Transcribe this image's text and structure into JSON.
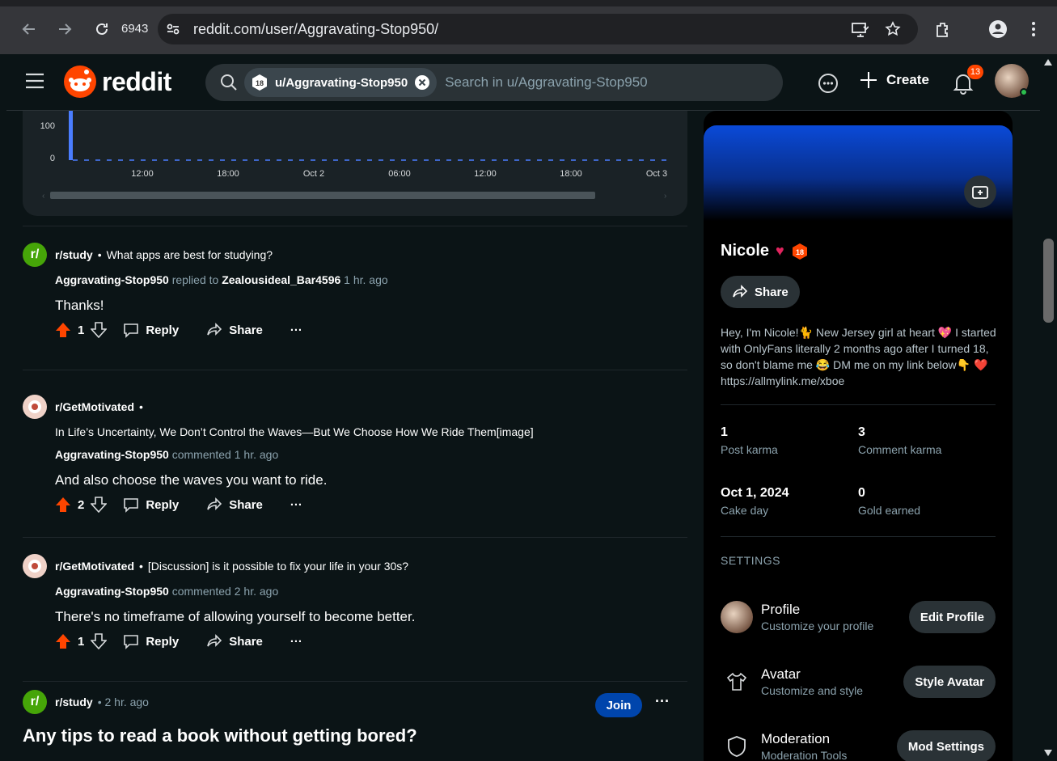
{
  "browser": {
    "tab_count": "6943",
    "url": "reddit.com/user/Aggravating-Stop950/"
  },
  "header": {
    "logo_text": "reddit",
    "search_chip": "u/Aggravating-Stop950",
    "search_chip_badge": "18",
    "search_placeholder": "Search in u/Aggravating-Stop950",
    "create_label": "Create",
    "notification_count": "13"
  },
  "activity_chart": {
    "y_ticks": [
      "100",
      "0"
    ],
    "x_ticks": [
      "12:00",
      "18:00",
      "Oct 2",
      "06:00",
      "12:00",
      "18:00",
      "Oct 3"
    ]
  },
  "feed": [
    {
      "subreddit": "r/study",
      "separator": "•",
      "post_title": "What apps are best for studying?",
      "author": "Aggravating-Stop950",
      "action": "replied to",
      "target": "Zealousideal_Bar4596",
      "time": "1 hr. ago",
      "body": "Thanks!",
      "score": "1",
      "reply": "Reply",
      "share": "Share",
      "more": "···"
    },
    {
      "subreddit": "r/GetMotivated",
      "separator": "•",
      "post_title": "In Life’s Uncertainty, We Don’t Control the Waves—But We Choose How We Ride Them[image]",
      "author": "Aggravating-Stop950",
      "action": "commented",
      "time": "1 hr. ago",
      "body": "And also choose the waves you want to ride.",
      "score": "2",
      "reply": "Reply",
      "share": "Share",
      "more": "···"
    },
    {
      "subreddit": "r/GetMotivated",
      "separator": "•",
      "post_title": "[Discussion] is it possible to fix your life in your 30s?",
      "author": "Aggravating-Stop950",
      "action": "commented",
      "time": "2 hr. ago",
      "body": "There's no timeframe of allowing yourself to become better.",
      "score": "1",
      "reply": "Reply",
      "share": "Share",
      "more": "···"
    }
  ],
  "post": {
    "subreddit": "r/study",
    "time": "• 2 hr. ago",
    "join": "Join",
    "more": "···",
    "title": "Any tips to read a book without getting bored?"
  },
  "profile": {
    "name": "Nicole",
    "badge": "18",
    "share": "Share",
    "bio": "Hey, I'm Nicole!🐈 New Jersey girl at heart 💖 I started with OnlyFans literally 2 months ago after I turned 18, so don't blame me 😂 DM me on my link below👇 ❤️ https://allmylink.me/xboe",
    "stats": [
      {
        "value": "1",
        "label": "Post karma"
      },
      {
        "value": "3",
        "label": "Comment karma"
      },
      {
        "value": "Oct 1, 2024",
        "label": "Cake day"
      },
      {
        "value": "0",
        "label": "Gold earned"
      }
    ],
    "settings_heading": "SETTINGS",
    "settings": [
      {
        "title": "Profile",
        "subtitle": "Customize your profile",
        "button": "Edit Profile"
      },
      {
        "title": "Avatar",
        "subtitle": "Customize and style",
        "button": "Style Avatar"
      },
      {
        "title": "Moderation",
        "subtitle": "Moderation Tools",
        "button": "Mod Settings"
      }
    ]
  },
  "colors": {
    "upvote": "#ff4500",
    "join": "#0045ac",
    "chart_bar": "#4a7dff",
    "background": "#0b1416"
  }
}
